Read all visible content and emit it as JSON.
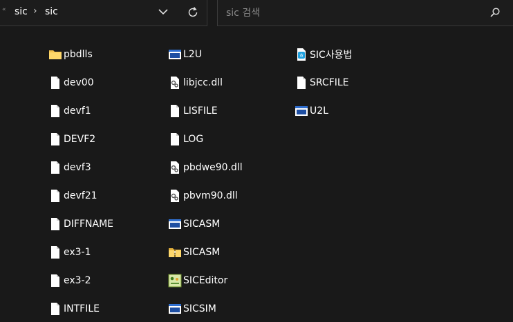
{
  "address_bar": {
    "overflow_glyph": "«",
    "breadcrumbs": [
      "sic",
      "sic"
    ],
    "separator": "›"
  },
  "search": {
    "placeholder": "sic 검색"
  },
  "columns": [
    {
      "items": [
        {
          "name": "pbdlls",
          "icon": "folder-icon"
        },
        {
          "name": "dev00",
          "icon": "file-icon"
        },
        {
          "name": "devf1",
          "icon": "file-icon"
        },
        {
          "name": "DEVF2",
          "icon": "file-icon"
        },
        {
          "name": "devf3",
          "icon": "file-icon"
        },
        {
          "name": "devf21",
          "icon": "file-icon"
        },
        {
          "name": "DIFFNAME",
          "icon": "file-icon"
        },
        {
          "name": "ex3-1",
          "icon": "file-icon"
        },
        {
          "name": "ex3-2",
          "icon": "file-icon"
        },
        {
          "name": "INTFILE",
          "icon": "file-icon"
        }
      ]
    },
    {
      "items": [
        {
          "name": "L2U",
          "icon": "application-icon"
        },
        {
          "name": "libjcc.dll",
          "icon": "dll-icon"
        },
        {
          "name": "LISFILE",
          "icon": "file-icon"
        },
        {
          "name": "LOG",
          "icon": "file-icon"
        },
        {
          "name": "pbdwe90.dll",
          "icon": "dll-icon"
        },
        {
          "name": "pbvm90.dll",
          "icon": "dll-icon"
        },
        {
          "name": "SICASM",
          "icon": "application-icon"
        },
        {
          "name": "SICASM",
          "icon": "zip-folder-icon"
        },
        {
          "name": "SICEditor",
          "icon": "editor-app-icon"
        },
        {
          "name": "SICSIM",
          "icon": "application-icon"
        }
      ]
    },
    {
      "items": [
        {
          "name": "SIC사용법",
          "icon": "hwp-document-icon"
        },
        {
          "name": "SRCFILE",
          "icon": "file-icon"
        },
        {
          "name": "U2L",
          "icon": "application-icon"
        }
      ]
    }
  ]
}
